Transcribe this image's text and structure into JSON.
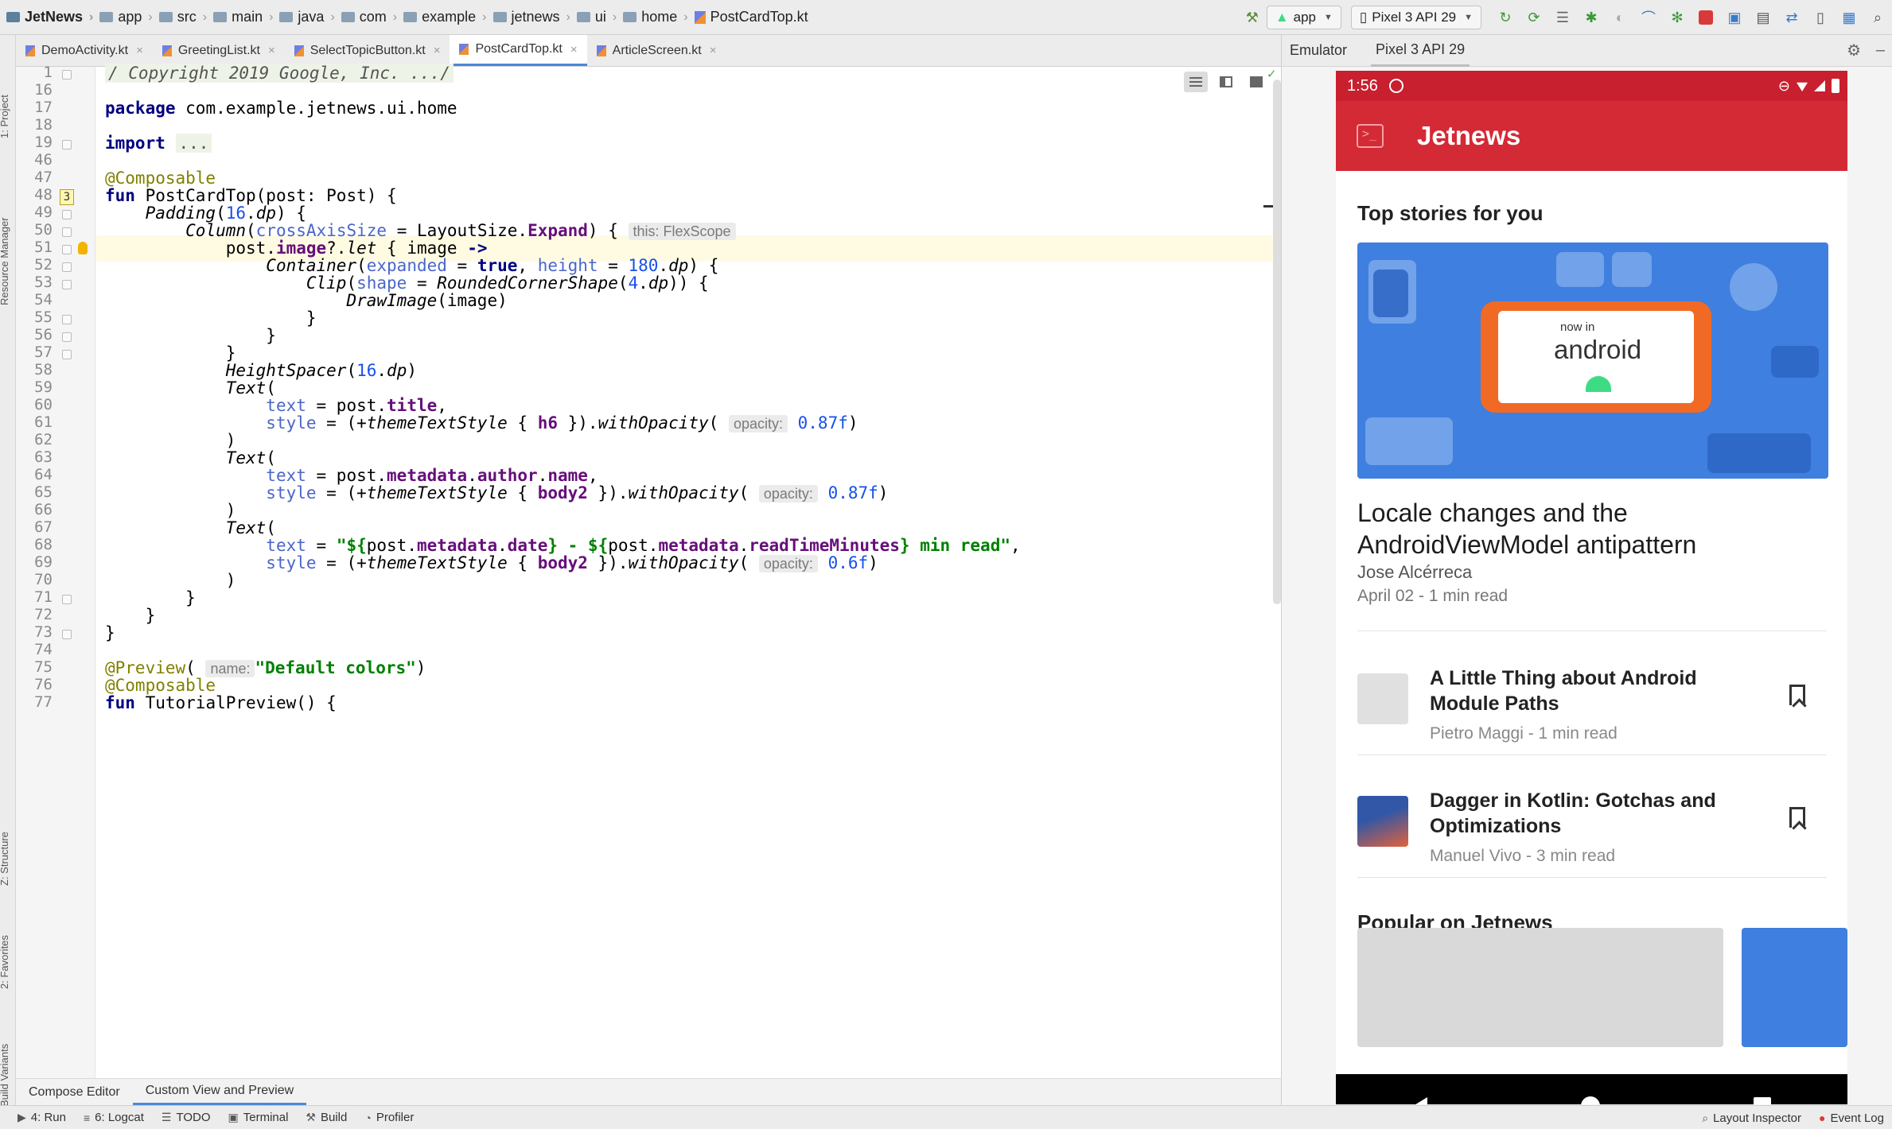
{
  "breadcrumbs": [
    "JetNews",
    "app",
    "src",
    "main",
    "java",
    "com",
    "example",
    "jetnews",
    "ui",
    "home",
    "PostCardTop.kt"
  ],
  "toolbar": {
    "run_config": "app",
    "device": "Pixel 3 API 29"
  },
  "left_strip": [
    "1: Project",
    "Resource Manager",
    "Z: Structure",
    "2: Favorites",
    "Build Variants"
  ],
  "editor_tabs": [
    {
      "label": "DemoActivity.kt",
      "active": false
    },
    {
      "label": "GreetingList.kt",
      "active": false
    },
    {
      "label": "SelectTopicButton.kt",
      "active": false
    },
    {
      "label": "PostCardTop.kt",
      "active": true
    },
    {
      "label": "ArticleScreen.kt",
      "active": false
    }
  ],
  "code": {
    "line_numbers": [
      "1",
      "16",
      "17",
      "18",
      "19",
      "46",
      "47",
      "48",
      "49",
      "50",
      "51",
      "52",
      "53",
      "54",
      "55",
      "56",
      "57",
      "58",
      "59",
      "60",
      "61",
      "62",
      "63",
      "64",
      "65",
      "66",
      "67",
      "68",
      "69",
      "70",
      "71",
      "72",
      "73",
      "74",
      "75",
      "76",
      "77"
    ],
    "highlighted_line": "51",
    "gutter_badge": "3",
    "hints": {
      "this": "this: FlexScope",
      "opacity": "opacity:",
      "name": "name:"
    }
  },
  "bottom_editor_tabs": [
    "Compose Editor",
    "Custom View and Preview"
  ],
  "status_bar": {
    "left": [
      "4: Run",
      "6: Logcat",
      "TODO",
      "Terminal",
      "Build",
      "Profiler"
    ],
    "right": [
      "Layout Inspector",
      "Event Log"
    ]
  },
  "emulator": {
    "header_label": "Emulator",
    "device_tab": "Pixel 3 API 29",
    "status_time": "1:56",
    "app_title": "Jetnews",
    "section_top": "Top stories for you",
    "hero_now_in": "now in",
    "hero_android": "android",
    "featured": {
      "title": "Locale changes and the AndroidViewModel antipattern",
      "author": "Jose Alcérreca",
      "meta": "April 02 - 1 min read"
    },
    "posts": [
      {
        "title": "A Little Thing about Android Module Paths",
        "meta": "Pietro Maggi - 1 min read"
      },
      {
        "title": "Dagger in Kotlin: Gotchas and Optimizations",
        "meta": "Manuel Vivo - 3 min read"
      }
    ],
    "section_popular": "Popular on Jetnews"
  },
  "colors": {
    "app_bar": "#d42a36",
    "status_bar": "#c8202e",
    "hero": "#3f7fdf",
    "active_tab": "#4a88d8"
  }
}
